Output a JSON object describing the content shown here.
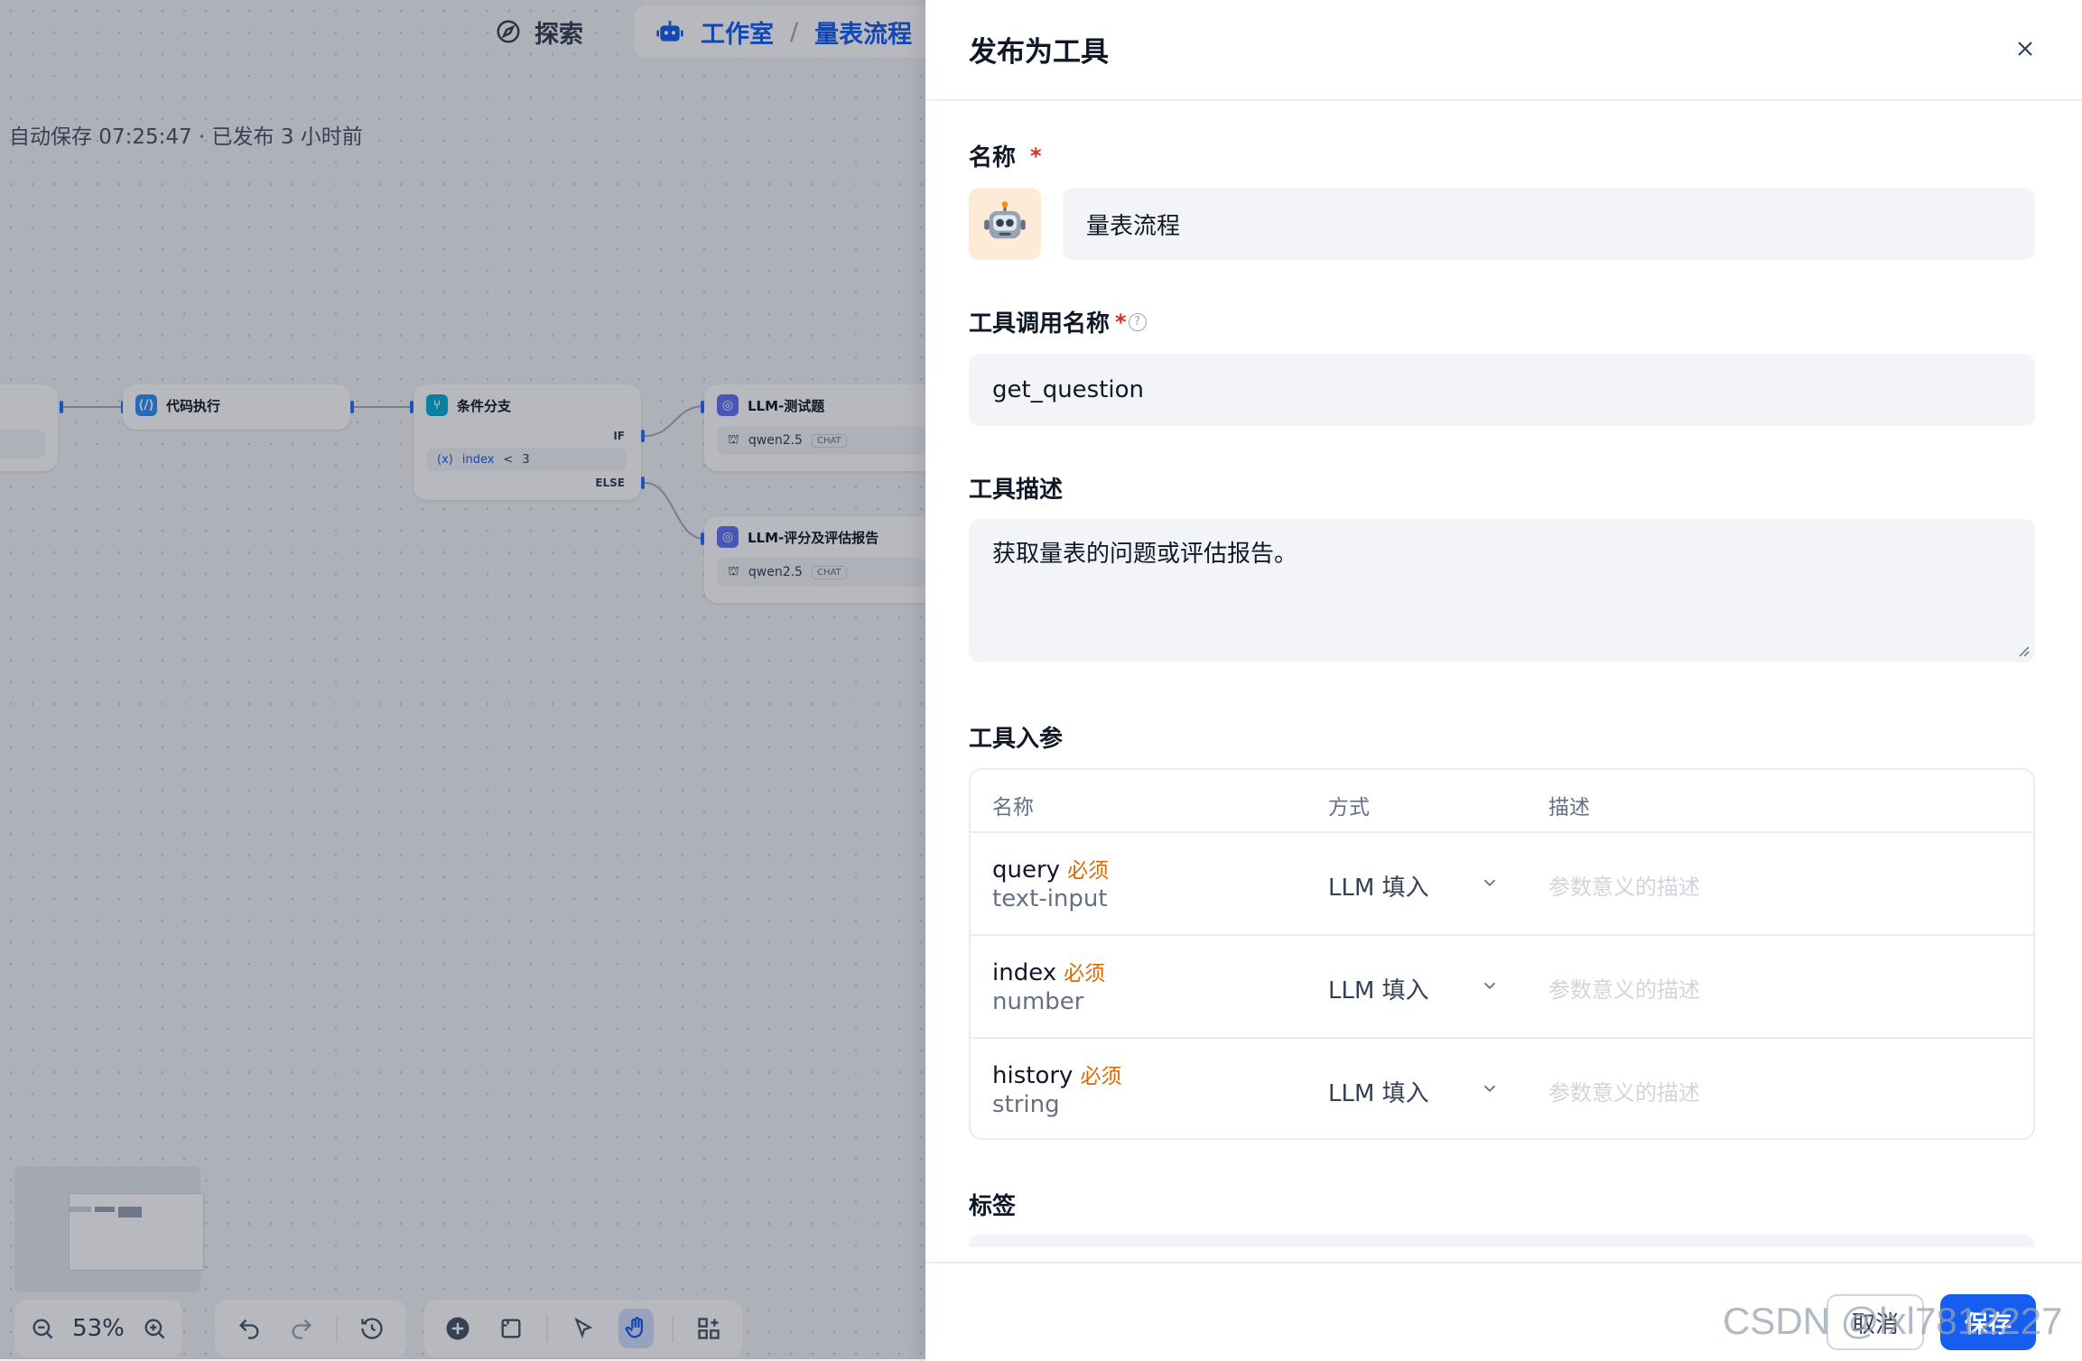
{
  "topnav": {
    "explore": "探索",
    "studio": "工作室",
    "separator": "/",
    "app_name": "量表流程"
  },
  "status": {
    "autosave_text": "自动保存 07:25:47 · 已发布 3 小时前"
  },
  "nodes": {
    "code": {
      "title": "代码执行"
    },
    "branch": {
      "title": "条件分支",
      "if_label": "IF",
      "else_label": "ELSE",
      "condition_var": "index",
      "condition_op": "<",
      "condition_val": "3"
    },
    "llm1": {
      "title": "LLM-测试题",
      "model": "qwen2.5",
      "mode": "CHAT"
    },
    "llm2": {
      "title": "LLM-评分及评估报告",
      "model": "qwen2.5",
      "mode": "CHAT"
    }
  },
  "toolbar": {
    "zoom": "53%"
  },
  "drawer": {
    "title": "发布为工具",
    "name_label": "名称",
    "required_mark": "*",
    "name_value": "量表流程",
    "call_name_label": "工具调用名称",
    "call_name_value": "get_question",
    "desc_label": "工具描述",
    "desc_value": "获取量表的问题或评估报告。",
    "params_label": "工具入参",
    "params_headers": {
      "name": "名称",
      "mode": "方式",
      "desc": "描述"
    },
    "params": [
      {
        "name": "query",
        "required": "必须",
        "type": "text-input",
        "mode": "LLM 填入",
        "desc_placeholder": "参数意义的描述"
      },
      {
        "name": "index",
        "required": "必须",
        "type": "number",
        "mode": "LLM 填入",
        "desc_placeholder": "参数意义的描述"
      },
      {
        "name": "history",
        "required": "必须",
        "type": "string",
        "mode": "LLM 填入",
        "desc_placeholder": "参数意义的描述"
      }
    ],
    "tags_label": "标签",
    "cancel_label": "取消",
    "save_label": "保存"
  },
  "watermark": "CSDN @lxl7812227",
  "colors": {
    "accent": "#155eef",
    "required": "#d92d20",
    "required_tag": "#dc6803",
    "overlay": "#000000"
  },
  "icons": [
    "explore-icon",
    "robot-icon",
    "close-icon",
    "help-icon",
    "chevron-down-icon",
    "zoom-out-icon",
    "zoom-in-icon",
    "undo-icon",
    "redo-icon",
    "history-icon",
    "add-icon",
    "note-icon",
    "pointer-icon",
    "hand-icon",
    "layout-icon"
  ]
}
